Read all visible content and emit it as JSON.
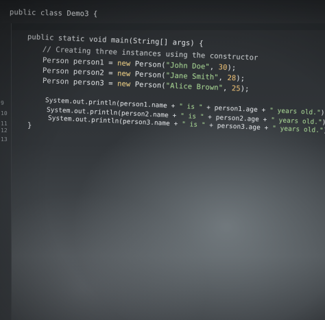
{
  "editor": {
    "class_declaration": "public class Demo3 {",
    "method_signature": "public static void main(String[] args) {",
    "comment": "// Creating three instances using the constructor",
    "person1": {
      "decl": "Person person1 = ",
      "new_kw": "new",
      "ctor": " Person(",
      "name": "\"John Doe\"",
      "sep": ", ",
      "age": "30",
      "end": ");"
    },
    "person2": {
      "decl": "Person person2 = ",
      "new_kw": "new",
      "ctor": " Person(",
      "name": "\"Jane Smith\"",
      "sep": ", ",
      "age": "28",
      "end": ");"
    },
    "person3": {
      "decl": "Person person3 = ",
      "new_kw": "new",
      "ctor": " Person(",
      "name": "\"Alice Brown\"",
      "sep": ", ",
      "age": "25",
      "end": ");"
    },
    "print1": {
      "pre": "System.out.println(person1.name + ",
      "is": "\" is \"",
      "mid": " + person1.age + ",
      "years": "\" years old.\"",
      "end": ");"
    },
    "print2": {
      "pre": "System.out.println(person2.name + ",
      "is": "\" is \"",
      "mid": " + person2.age + ",
      "years": "\" years old.\"",
      "end": ");"
    },
    "print3": {
      "pre": "System.out.println(person3.name + ",
      "is": "\" is \"",
      "mid": " + person3.age + ",
      "years": "\" years old.\"",
      "end": ");"
    },
    "method_close": "}",
    "line_numbers": [
      "9",
      "10",
      "11",
      "12",
      "13"
    ]
  }
}
